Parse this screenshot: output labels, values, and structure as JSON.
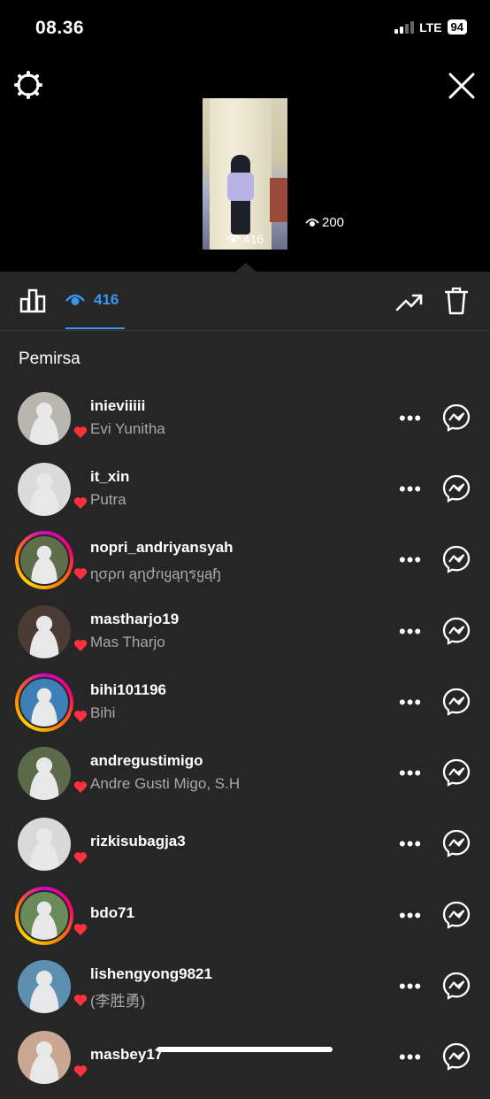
{
  "status": {
    "time": "08.36",
    "network": "LTE",
    "battery": "94"
  },
  "preview": {
    "thumb_count": "416",
    "side_count": "200"
  },
  "toolbar": {
    "viewers_count": "416"
  },
  "section_title": "Pemirsa",
  "viewers": [
    {
      "username": "inieviiiii",
      "name": "Evi Yunitha",
      "ring": false,
      "avatar_color": "#b9b6b0"
    },
    {
      "username": "it_xin",
      "name": "Putra",
      "ring": false,
      "avatar_color": "#dbdbdb"
    },
    {
      "username": "nopri_andriyansyah",
      "name": "ɳσρɾι ąɳժɾιყąɳรყąɧ",
      "ring": true,
      "avatar_color": "#5f6e4a"
    },
    {
      "username": "mastharjo19",
      "name": "Mas Tharjo",
      "ring": false,
      "avatar_color": "#4a3b34"
    },
    {
      "username": "bihi101196",
      "name": "Bihi",
      "ring": true,
      "avatar_color": "#3f7fb8"
    },
    {
      "username": "andregustimigo",
      "name": "Andre Gusti Migo, S.H",
      "ring": false,
      "avatar_color": "#5b6b4a"
    },
    {
      "username": "rizkisubagja3",
      "name": "",
      "ring": false,
      "avatar_color": "#d9d9d9"
    },
    {
      "username": "bdo71",
      "name": "",
      "ring": true,
      "avatar_color": "#6a8a5a"
    },
    {
      "username": "lishengyong9821",
      "name": "(李胜勇)",
      "ring": false,
      "avatar_color": "#5c8fb0"
    },
    {
      "username": "masbey17",
      "name": "",
      "ring": false,
      "avatar_color": "#c9a793"
    }
  ],
  "more_label": "•••"
}
